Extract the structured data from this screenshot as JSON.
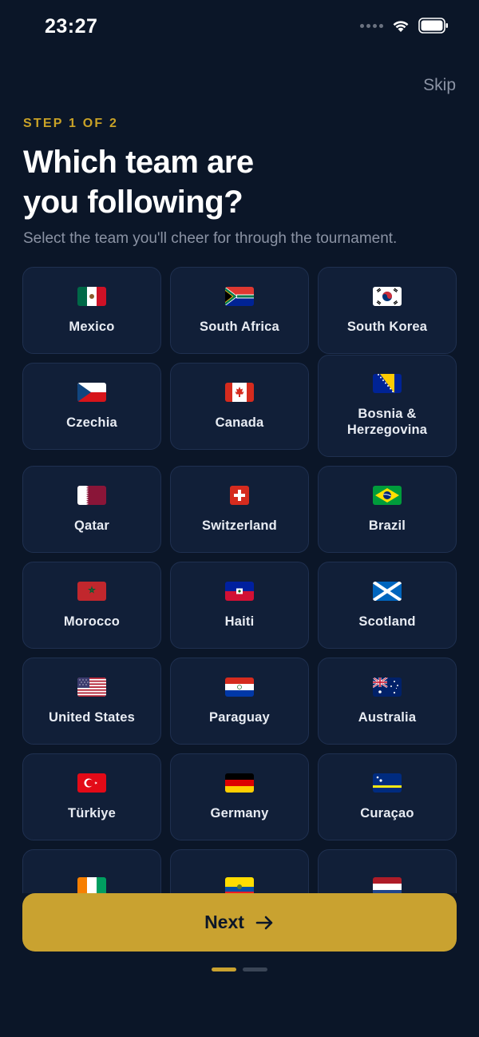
{
  "status_bar": {
    "time": "23:27"
  },
  "header": {
    "skip_label": "Skip",
    "step_label": "STEP 1 OF 2",
    "title_line1": "Which team are",
    "title_line2": "you following?",
    "subtitle": "Select the team you'll cheer for through the tournament."
  },
  "teams": [
    {
      "name": "Mexico",
      "flag_icon": "mexico-flag-icon"
    },
    {
      "name": "South Africa",
      "flag_icon": "south-africa-flag-icon"
    },
    {
      "name": "South Korea",
      "flag_icon": "south-korea-flag-icon"
    },
    {
      "name": "Czechia",
      "flag_icon": "czechia-flag-icon"
    },
    {
      "name": "Canada",
      "flag_icon": "canada-flag-icon"
    },
    {
      "name": "Bosnia &",
      "name2": "Herzegovina",
      "flag_icon": "bosnia-flag-icon"
    },
    {
      "name": "Qatar",
      "flag_icon": "qatar-flag-icon"
    },
    {
      "name": "Switzerland",
      "flag_icon": "switzerland-flag-icon"
    },
    {
      "name": "Brazil",
      "flag_icon": "brazil-flag-icon"
    },
    {
      "name": "Morocco",
      "flag_icon": "morocco-flag-icon"
    },
    {
      "name": "Haiti",
      "flag_icon": "haiti-flag-icon"
    },
    {
      "name": "Scotland",
      "flag_icon": "scotland-flag-icon"
    },
    {
      "name": "United States",
      "flag_icon": "usa-flag-icon"
    },
    {
      "name": "Paraguay",
      "flag_icon": "paraguay-flag-icon"
    },
    {
      "name": "Australia",
      "flag_icon": "australia-flag-icon"
    },
    {
      "name": "Türkiye",
      "flag_icon": "turkiye-flag-icon"
    },
    {
      "name": "Germany",
      "flag_icon": "germany-flag-icon"
    },
    {
      "name": "Curaçao",
      "flag_icon": "curacao-flag-icon"
    }
  ],
  "footer": {
    "next_label": "Next"
  },
  "colors": {
    "background": "#0b1628",
    "card": "#111f38",
    "accent": "#c9a230",
    "muted": "#8b93a4"
  }
}
